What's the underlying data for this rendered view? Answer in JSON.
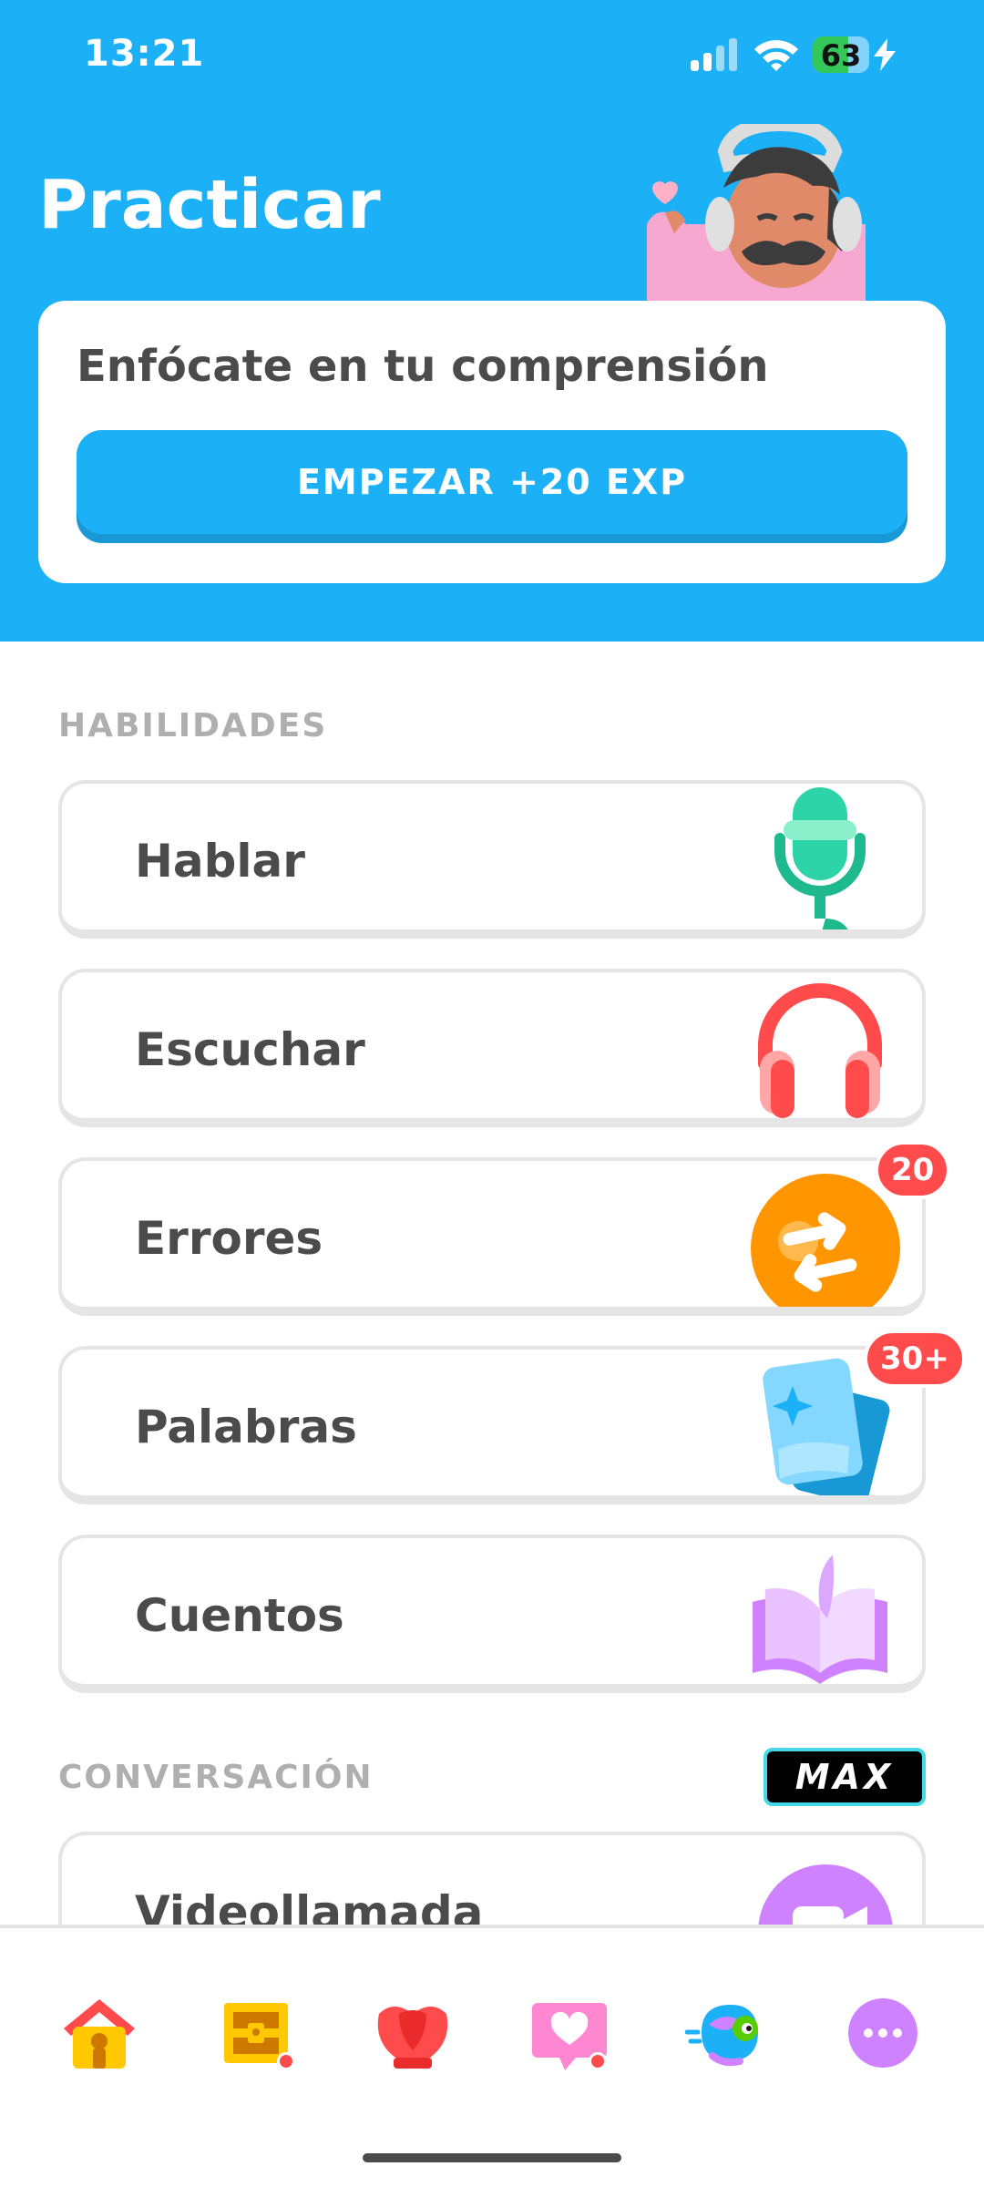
{
  "status_bar": {
    "time": "13:21",
    "battery": "63",
    "battery_level": 0.63
  },
  "header": {
    "title": "Practicar"
  },
  "focus_card": {
    "text": "Enfócate en tu comprensión",
    "button_label": "EMPEZAR +20 EXP"
  },
  "sections": [
    {
      "label": "HABILIDADES",
      "items": [
        {
          "label": "Hablar",
          "icon": "microphone-icon"
        },
        {
          "label": "Escuchar",
          "icon": "headphones-icon"
        },
        {
          "label": "Errores",
          "icon": "review-mistakes-icon",
          "badge": "20"
        },
        {
          "label": "Palabras",
          "icon": "flashcards-icon",
          "badge": "30+"
        },
        {
          "label": "Cuentos",
          "icon": "book-icon"
        }
      ]
    },
    {
      "label": "CONVERSACIÓN",
      "tag": "MAX",
      "items": [
        {
          "label": "Videollamada",
          "icon": "video-call-icon"
        }
      ]
    }
  ],
  "bottom_nav": [
    {
      "name": "home-icon",
      "has_dot": false
    },
    {
      "name": "treasure-chest-icon",
      "has_dot": true
    },
    {
      "name": "shield-icon",
      "has_dot": false
    },
    {
      "name": "heart-chat-icon",
      "has_dot": true
    },
    {
      "name": "mascot-icon",
      "has_dot": false
    },
    {
      "name": "more-icon",
      "has_dot": false
    }
  ],
  "colors": {
    "primary_blue": "#1cb0f6",
    "button_shadow": "#1899d6",
    "badge_red": "#ff4b4b",
    "text_dark": "#4b4b4b",
    "text_gray": "#afafaf",
    "max_border": "#44d7e6"
  }
}
